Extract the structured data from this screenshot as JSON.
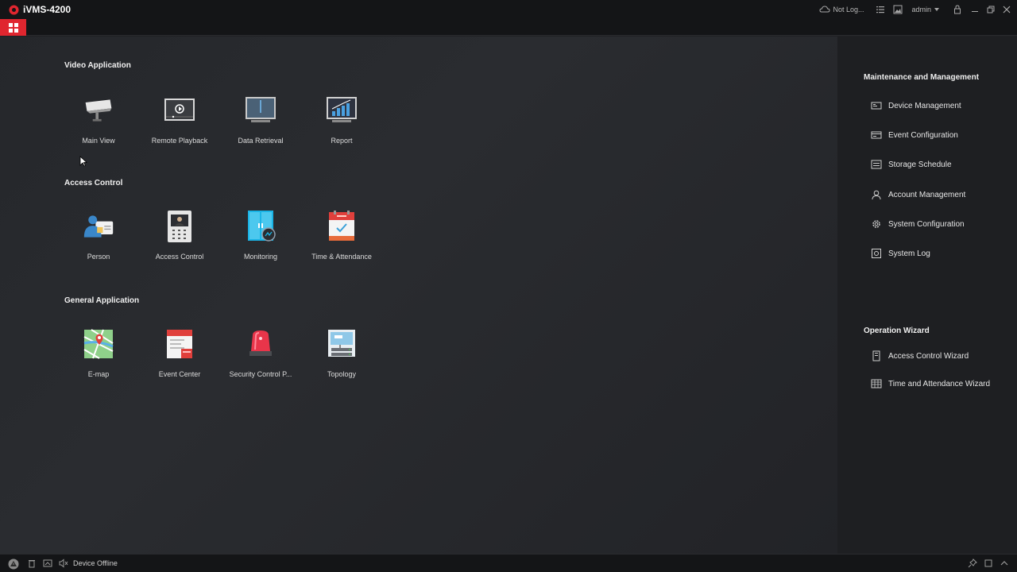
{
  "app": {
    "title": "iVMS-4200",
    "brand_color": "#e0262f"
  },
  "titlebar": {
    "cloud_status": "Not Log...",
    "user": "admin",
    "icons": [
      "cloud-icon",
      "list-icon",
      "image-icon",
      "user-dropdown",
      "lock-icon",
      "minimize-icon",
      "restore-icon",
      "close-icon"
    ]
  },
  "sections": {
    "video": {
      "title": "Video Application",
      "tiles": [
        "Main View",
        "Remote Playback",
        "Data Retrieval",
        "Report"
      ]
    },
    "access": {
      "title": "Access Control",
      "tiles": [
        "Person",
        "Access Control",
        "Monitoring",
        "Time & Attendance"
      ]
    },
    "general": {
      "title": "General Application",
      "tiles": [
        "E-map",
        "Event Center",
        "Security Control P...",
        "Topology"
      ]
    }
  },
  "maintenance": {
    "title": "Maintenance and Management",
    "items": [
      "Device Management",
      "Event Configuration",
      "Storage Schedule",
      "Account Management",
      "System Configuration",
      "System Log"
    ]
  },
  "wizard": {
    "title": "Operation Wizard",
    "items": [
      "Access Control Wizard",
      "Time and Attendance Wizard"
    ]
  },
  "statusbar": {
    "text": "Device Offline"
  }
}
